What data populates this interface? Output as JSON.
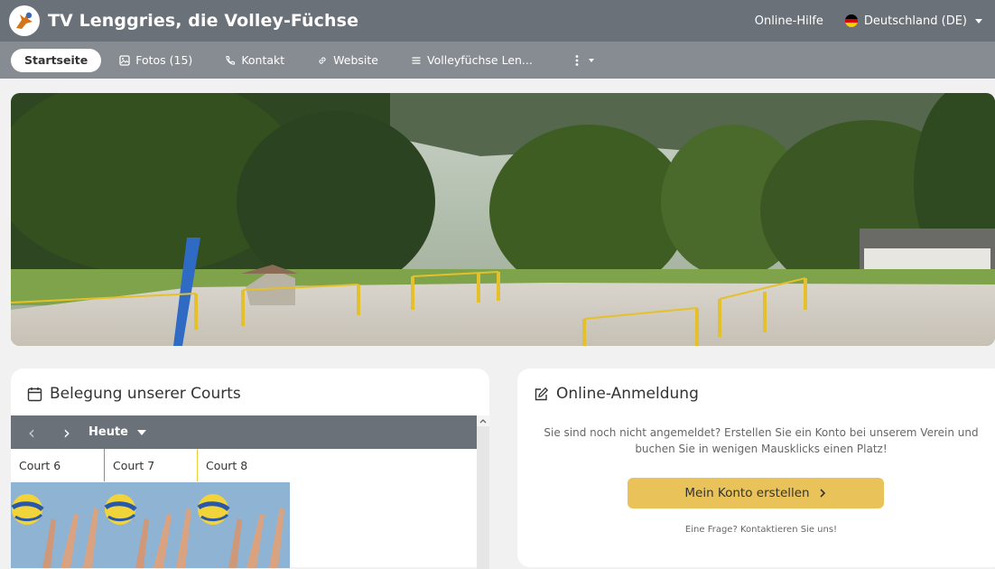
{
  "header": {
    "title": "TV Lenggries, die Volley-Füchse",
    "help": "Online-Hilfe",
    "language": "Deutschland (DE)"
  },
  "nav": {
    "items": [
      {
        "label": "Startseite",
        "icon": "home"
      },
      {
        "label": "Fotos (15)",
        "icon": "image-icon"
      },
      {
        "label": "Kontakt",
        "icon": "phone-icon"
      },
      {
        "label": "Website",
        "icon": "link-icon"
      },
      {
        "label": "Volleyfüchse Len...",
        "icon": "menu-lines-icon"
      }
    ],
    "more": "more-vertical-icon"
  },
  "calendar": {
    "title": "Belegung unserer Courts",
    "today": "Heute",
    "courts": [
      "Court 6",
      "Court 7",
      "Court 8"
    ]
  },
  "signup": {
    "title": "Online-Anmeldung",
    "text_line1": "Sie sind noch nicht angemeldet? Erstellen Sie ein Konto bei unserem Verein und",
    "text_line2": "buchen Sie in wenigen Mausklicks einen Platz!",
    "button": "Mein Konto erstellen",
    "question": "Eine Frage? Kontaktieren Sie uns!"
  },
  "colors": {
    "header": "#6b7178",
    "nav": "#868c92",
    "cta": "#e9c35a"
  }
}
